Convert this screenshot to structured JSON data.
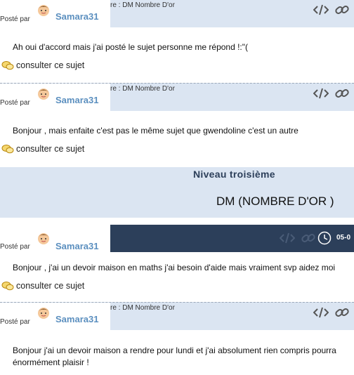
{
  "posts": [
    {
      "posted_by": "Posté par",
      "author": "Samara31",
      "subject": "re : DM Nombre D'or",
      "body": "Ah oui d'accord mais j'ai posté le sujet personne me répond !:\"(",
      "consult": "consulter ce sujet"
    },
    {
      "posted_by": "Posté par",
      "author": "Samara31",
      "subject": "re : DM Nombre D'or",
      "body": "Bonjour , mais enfaite c'est pas le même sujet que gwendoline c'est un autre",
      "consult": "consulter ce sujet"
    },
    {
      "posted_by": "Posté par",
      "author": "Samara31",
      "time": "05-0",
      "body": "Bonjour , j'ai un devoir maison en maths j'ai besoin d'aide mais vraiment svp aidez moi",
      "consult": "consulter ce sujet"
    },
    {
      "posted_by": "Posté par",
      "author": "Samara31",
      "subject": "re : DM Nombre D'or",
      "body_line1": "Bonjour j'ai un devoir maison a rendre pour lundi et j'ai absolument rien compris pourra",
      "body_line2": "énormément plaisir !"
    }
  ],
  "section": {
    "level": "Niveau troisième",
    "topic": "DM (NOMBRE D'OR )"
  },
  "icons": [
    "code-icon",
    "link-icon",
    "clock-icon",
    "bubble-icon",
    "avatar"
  ],
  "colors": {
    "header_bg": "#dbe5f2",
    "dark_header_bg": "#2c3f5a",
    "author": "#5b8fbf",
    "section_title": "#2c3f5a"
  }
}
